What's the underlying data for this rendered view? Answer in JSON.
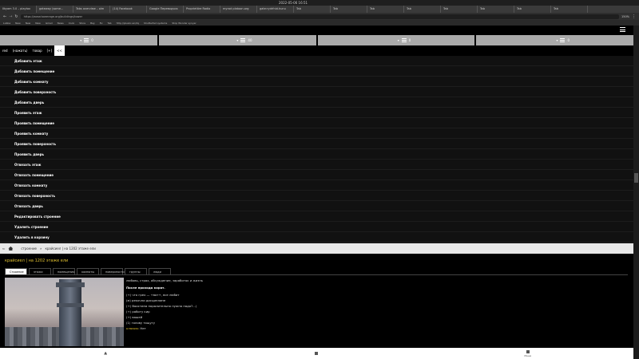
{
  "browser": {
    "clock": "2022-05-06 16:51",
    "tabs": [
      "Ilkyam 3.0 – playtox",
      "gateway (some...",
      "Tabs overview – olm",
      "(14) Facebook",
      "Google Переводчик",
      "Proprietäre Radio",
      "myrad platoon.org",
      "gate:rydrfnid.hunu",
      "Tab",
      "Tab",
      "Tab",
      "Tab",
      "Tab",
      "Tab",
      "Tab",
      "Tab"
    ],
    "url": "https://www.towerage.org/buildings/tower",
    "zoom": "150%",
    "bookmarks": [
      "Lubba",
      "New",
      "New",
      "New",
      "Gmail",
      "News",
      "Cook",
      "Store",
      "Bay",
      "Ev",
      "Tab",
      "http://plusbc.en/dq",
      "Shutterfed systems",
      "Stop Wonder synyer"
    ]
  },
  "menu": {
    "cells": [
      "▾",
      "▾",
      "▾",
      "▾"
    ],
    "cell_values": [
      "0",
      "40",
      "0",
      "0"
    ]
  },
  "crumbs": [
    "red",
    "(нажать)",
    "товар",
    "[+]",
    "<<"
  ],
  "actions": [
    "Добавить этаж",
    "Добавить помещение",
    "Добавить комнату",
    "Добавить поверхность",
    "Добавить дверь",
    "Проявить этаж",
    "Проявить помещение",
    "Проявить комнату",
    "Проявить поверхность",
    "Проявить дверь",
    "Отвязать этаж",
    "Отвязать помещение",
    "Отвязать комнату",
    "Отвязать поверхность",
    "Отвязать дверь",
    "Редактировать строение",
    "Удалить строение",
    "Удалить в корзину"
  ],
  "navbar": {
    "items": [
      "строение",
      "»",
      "крайсиел | на 1202 этаже ели"
    ]
  },
  "content": {
    "title": "крайсиел | на 1202 этаже ели",
    "tabs": [
      "Строение",
      "этажи",
      "помещения",
      "комнаты",
      "поверхности",
      "группы",
      "люди"
    ],
    "lines": [
      "любовь, страх, обсуждение, заработок и жизнь",
      "После прохода корот.",
      "(+) что грех — +вот+, все любит",
      "(м) рекочни дисциплине",
      "(+) Воистина поралительно нужно надо?...)",
      "(+) работу кир",
      "(+) вашей",
      "(1) голову тощугу",
      "ключик:",
      "Нет"
    ]
  },
  "bottombar": {
    "items": [
      "",
      "",
      "Меню"
    ]
  },
  "colors": {
    "accent_yellow": "#e0c030",
    "menu_gray": "#aaaaaa"
  }
}
